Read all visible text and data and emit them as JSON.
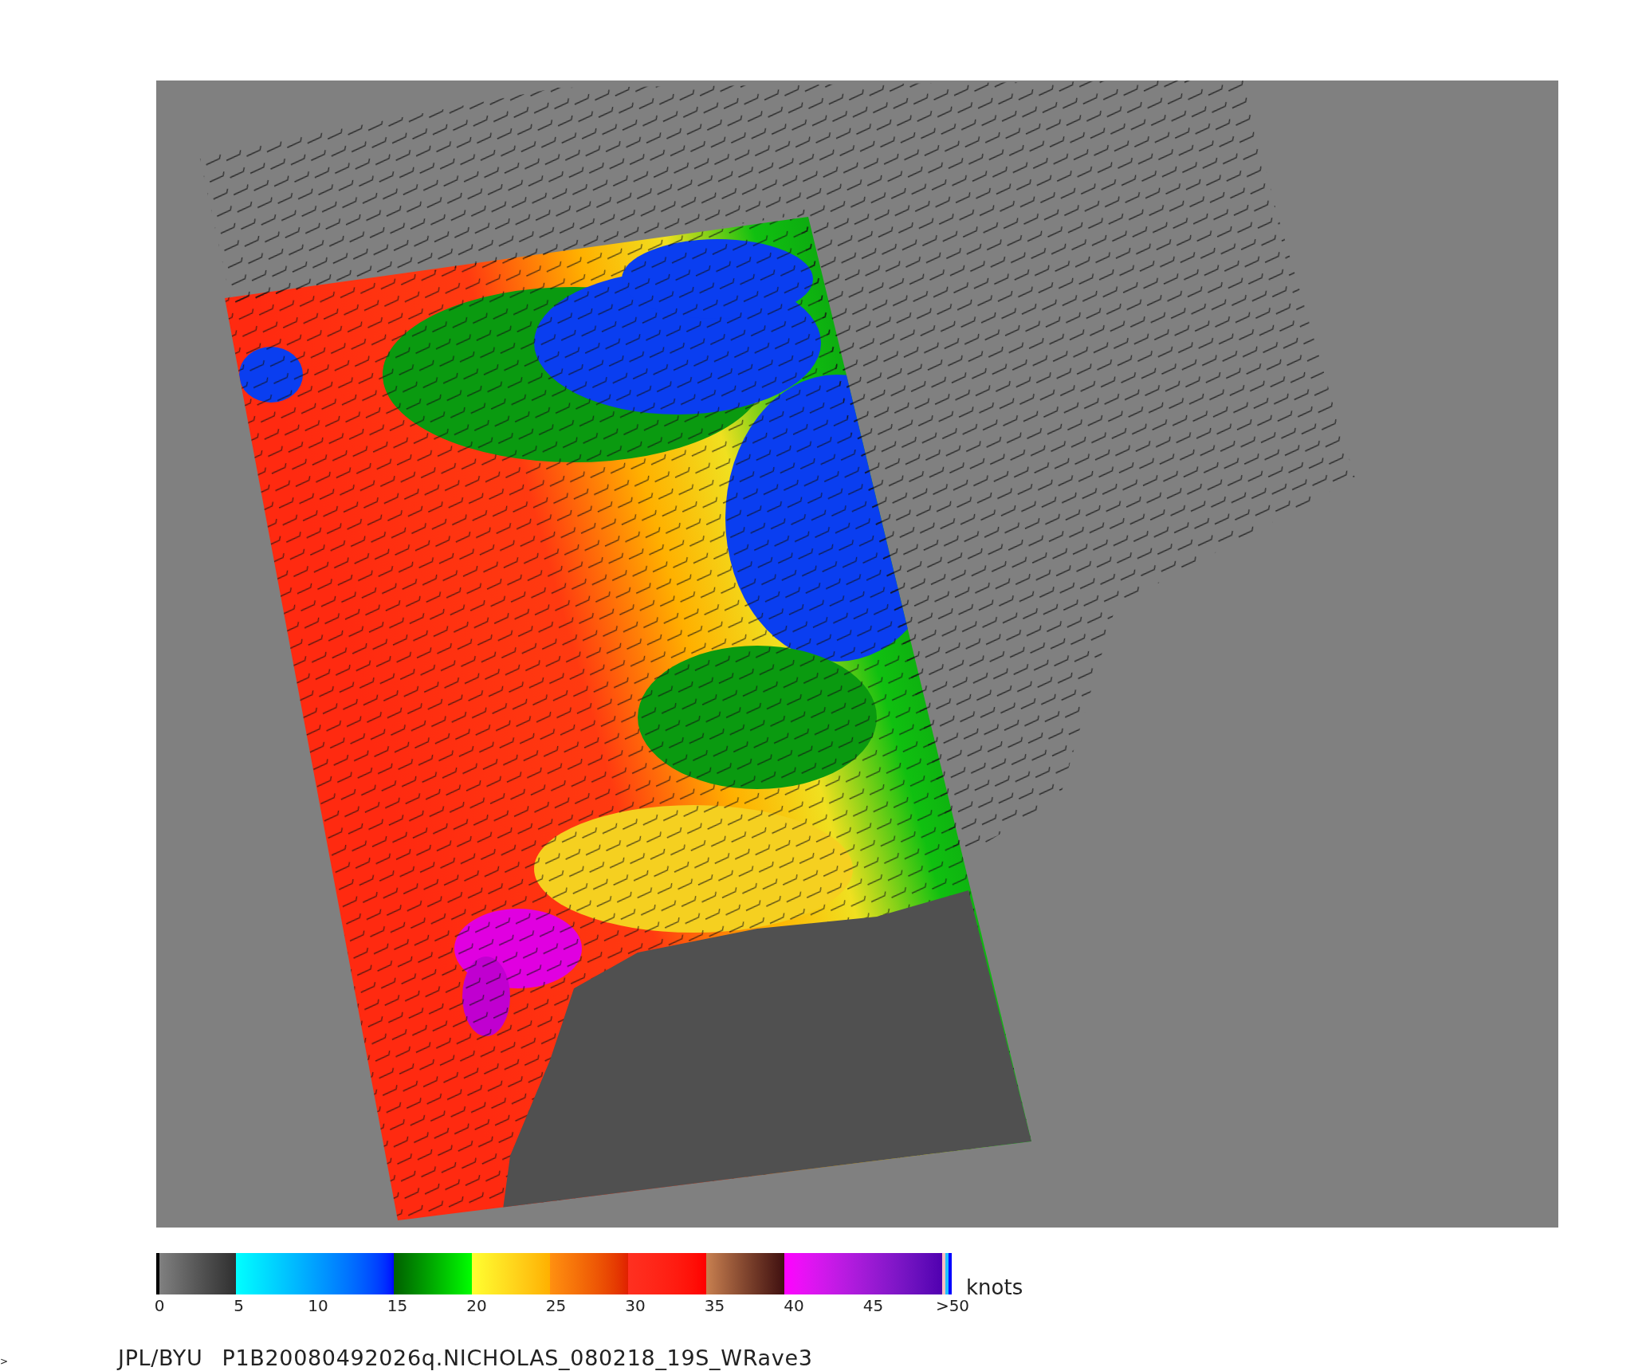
{
  "colorbar": {
    "ticks": [
      "0",
      "5",
      "10",
      "15",
      "20",
      "25",
      "30",
      "35",
      "40",
      "45",
      ">50"
    ],
    "unit": "knots"
  },
  "caption": {
    "source": "JPL/BYU",
    "file": "P1B20080492026q.NICHOLAS_080218_19S_WRave3"
  },
  "corner_mark": ">"
}
